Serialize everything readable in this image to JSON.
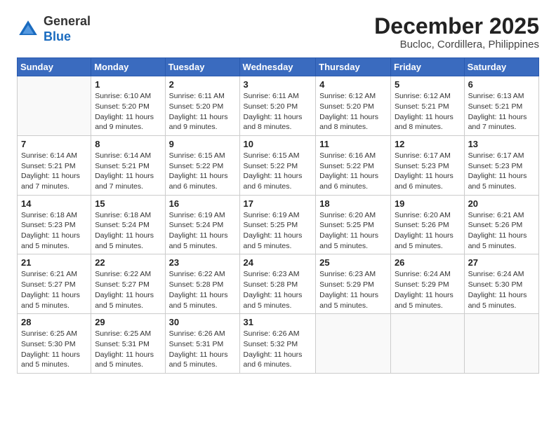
{
  "logo": {
    "general": "General",
    "blue": "Blue"
  },
  "header": {
    "title": "December 2025",
    "subtitle": "Bucloc, Cordillera, Philippines"
  },
  "weekdays": [
    "Sunday",
    "Monday",
    "Tuesday",
    "Wednesday",
    "Thursday",
    "Friday",
    "Saturday"
  ],
  "weeks": [
    [
      {
        "day": "",
        "info": ""
      },
      {
        "day": "1",
        "info": "Sunrise: 6:10 AM\nSunset: 5:20 PM\nDaylight: 11 hours\nand 9 minutes."
      },
      {
        "day": "2",
        "info": "Sunrise: 6:11 AM\nSunset: 5:20 PM\nDaylight: 11 hours\nand 9 minutes."
      },
      {
        "day": "3",
        "info": "Sunrise: 6:11 AM\nSunset: 5:20 PM\nDaylight: 11 hours\nand 8 minutes."
      },
      {
        "day": "4",
        "info": "Sunrise: 6:12 AM\nSunset: 5:20 PM\nDaylight: 11 hours\nand 8 minutes."
      },
      {
        "day": "5",
        "info": "Sunrise: 6:12 AM\nSunset: 5:21 PM\nDaylight: 11 hours\nand 8 minutes."
      },
      {
        "day": "6",
        "info": "Sunrise: 6:13 AM\nSunset: 5:21 PM\nDaylight: 11 hours\nand 7 minutes."
      }
    ],
    [
      {
        "day": "7",
        "info": "Sunrise: 6:14 AM\nSunset: 5:21 PM\nDaylight: 11 hours\nand 7 minutes."
      },
      {
        "day": "8",
        "info": "Sunrise: 6:14 AM\nSunset: 5:21 PM\nDaylight: 11 hours\nand 7 minutes."
      },
      {
        "day": "9",
        "info": "Sunrise: 6:15 AM\nSunset: 5:22 PM\nDaylight: 11 hours\nand 6 minutes."
      },
      {
        "day": "10",
        "info": "Sunrise: 6:15 AM\nSunset: 5:22 PM\nDaylight: 11 hours\nand 6 minutes."
      },
      {
        "day": "11",
        "info": "Sunrise: 6:16 AM\nSunset: 5:22 PM\nDaylight: 11 hours\nand 6 minutes."
      },
      {
        "day": "12",
        "info": "Sunrise: 6:17 AM\nSunset: 5:23 PM\nDaylight: 11 hours\nand 6 minutes."
      },
      {
        "day": "13",
        "info": "Sunrise: 6:17 AM\nSunset: 5:23 PM\nDaylight: 11 hours\nand 5 minutes."
      }
    ],
    [
      {
        "day": "14",
        "info": "Sunrise: 6:18 AM\nSunset: 5:23 PM\nDaylight: 11 hours\nand 5 minutes."
      },
      {
        "day": "15",
        "info": "Sunrise: 6:18 AM\nSunset: 5:24 PM\nDaylight: 11 hours\nand 5 minutes."
      },
      {
        "day": "16",
        "info": "Sunrise: 6:19 AM\nSunset: 5:24 PM\nDaylight: 11 hours\nand 5 minutes."
      },
      {
        "day": "17",
        "info": "Sunrise: 6:19 AM\nSunset: 5:25 PM\nDaylight: 11 hours\nand 5 minutes."
      },
      {
        "day": "18",
        "info": "Sunrise: 6:20 AM\nSunset: 5:25 PM\nDaylight: 11 hours\nand 5 minutes."
      },
      {
        "day": "19",
        "info": "Sunrise: 6:20 AM\nSunset: 5:26 PM\nDaylight: 11 hours\nand 5 minutes."
      },
      {
        "day": "20",
        "info": "Sunrise: 6:21 AM\nSunset: 5:26 PM\nDaylight: 11 hours\nand 5 minutes."
      }
    ],
    [
      {
        "day": "21",
        "info": "Sunrise: 6:21 AM\nSunset: 5:27 PM\nDaylight: 11 hours\nand 5 minutes."
      },
      {
        "day": "22",
        "info": "Sunrise: 6:22 AM\nSunset: 5:27 PM\nDaylight: 11 hours\nand 5 minutes."
      },
      {
        "day": "23",
        "info": "Sunrise: 6:22 AM\nSunset: 5:28 PM\nDaylight: 11 hours\nand 5 minutes."
      },
      {
        "day": "24",
        "info": "Sunrise: 6:23 AM\nSunset: 5:28 PM\nDaylight: 11 hours\nand 5 minutes."
      },
      {
        "day": "25",
        "info": "Sunrise: 6:23 AM\nSunset: 5:29 PM\nDaylight: 11 hours\nand 5 minutes."
      },
      {
        "day": "26",
        "info": "Sunrise: 6:24 AM\nSunset: 5:29 PM\nDaylight: 11 hours\nand 5 minutes."
      },
      {
        "day": "27",
        "info": "Sunrise: 6:24 AM\nSunset: 5:30 PM\nDaylight: 11 hours\nand 5 minutes."
      }
    ],
    [
      {
        "day": "28",
        "info": "Sunrise: 6:25 AM\nSunset: 5:30 PM\nDaylight: 11 hours\nand 5 minutes."
      },
      {
        "day": "29",
        "info": "Sunrise: 6:25 AM\nSunset: 5:31 PM\nDaylight: 11 hours\nand 5 minutes."
      },
      {
        "day": "30",
        "info": "Sunrise: 6:26 AM\nSunset: 5:31 PM\nDaylight: 11 hours\nand 5 minutes."
      },
      {
        "day": "31",
        "info": "Sunrise: 6:26 AM\nSunset: 5:32 PM\nDaylight: 11 hours\nand 6 minutes."
      },
      {
        "day": "",
        "info": ""
      },
      {
        "day": "",
        "info": ""
      },
      {
        "day": "",
        "info": ""
      }
    ]
  ]
}
